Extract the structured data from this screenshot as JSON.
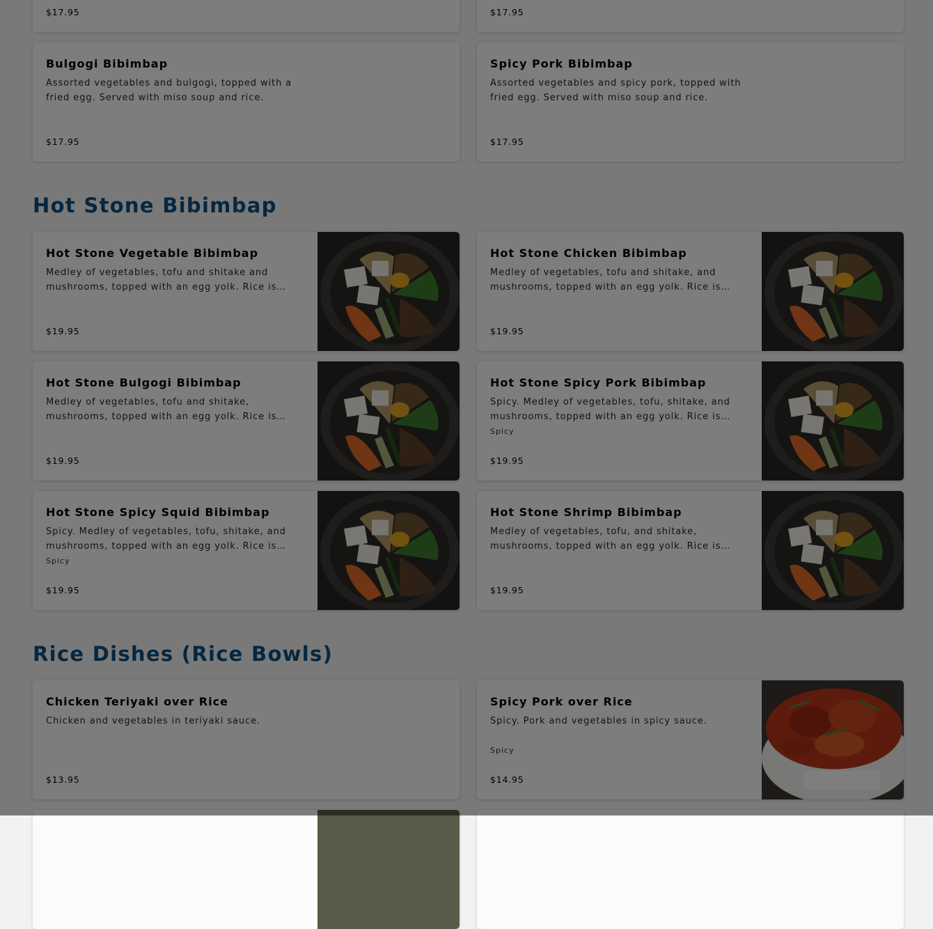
{
  "top_prices": [
    "$17.95",
    "$17.95"
  ],
  "bibimbap_items": [
    {
      "name": "Bulgogi Bibimbap",
      "description": "Assorted vegetables and bulgogi, topped with a fried egg. Served with miso soup and rice.",
      "price": "$17.95"
    },
    {
      "name": "Spicy Pork Bibimbap",
      "description": "Assorted vegetables and spicy pork, topped with fried egg. Served with miso soup and rice.",
      "price": "$17.95"
    }
  ],
  "sections": [
    {
      "title": "Hot Stone Bibimbap",
      "items": [
        {
          "name": "Hot Stone Vegetable Bibimbap",
          "description": "Medley of vegetables, tofu and shitake and mushrooms, topped with an egg yolk. Rice is heated in the hot stone bowl.",
          "tag": "",
          "price": "$19.95",
          "image": "bibimbap-photo"
        },
        {
          "name": "Hot Stone Chicken Bibimbap",
          "description": "Medley of vegetables, tofu and shitake, and mushrooms, topped with an egg yolk. Rice is heated in the hot stone bowl.",
          "tag": "",
          "price": "$19.95",
          "image": "bibimbap-photo"
        },
        {
          "name": "Hot Stone Bulgogi Bibimbap",
          "description": "Medley of vegetables, tofu and shitake, mushrooms, topped with an egg yolk. Rice is heated in the hot stone bowl.",
          "tag": "",
          "price": "$19.95",
          "image": "bibimbap-photo"
        },
        {
          "name": "Hot Stone Spicy Pork Bibimbap",
          "description": "Spicy. Medley of vegetables, tofu, shitake, and mushrooms, topped with an egg yolk. Rice is heated in the hot stone bowl.",
          "tag": "Spicy",
          "price": "$19.95",
          "image": "bibimbap-photo"
        },
        {
          "name": "Hot Stone Spicy Squid Bibimbap",
          "description": "Spicy. Medley of vegetables, tofu, shitake, and mushrooms, topped with an egg yolk. Rice is heated in the hot stone bowl.",
          "tag": "Spicy",
          "price": "$19.95",
          "image": "bibimbap-photo"
        },
        {
          "name": "Hot Stone Shrimp Bibimbap",
          "description": "Medley of vegetables, tofu, and shitake, mushrooms, topped with an egg yolk. Rice is heated in the hot stone bowl.",
          "tag": "",
          "price": "$19.95",
          "image": "bibimbap-photo"
        }
      ]
    },
    {
      "title": "Rice Dishes (Rice Bowls)",
      "items": [
        {
          "name": "Chicken Teriyaki over Rice",
          "description": "Chicken and vegetables in teriyaki sauce.",
          "tag": "",
          "price": "$13.95",
          "image": ""
        },
        {
          "name": "Spicy Pork over Rice",
          "description": "Spicy. Pork and vegetables in spicy sauce.",
          "tag": "Spicy",
          "price": "$14.95",
          "image": "spicy-pork-rice-photo"
        }
      ]
    }
  ],
  "colors": {
    "section_title": "#0f4f7e",
    "card_background": "#fbfbfb",
    "page_background": "#f2f2f2",
    "modal_overlay": "rgba(0,0,0,0.5)"
  }
}
